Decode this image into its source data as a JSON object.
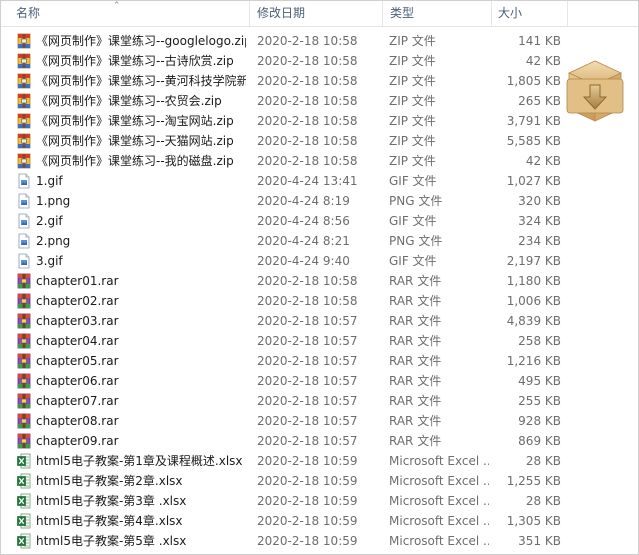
{
  "columns": {
    "name": "名称",
    "date": "修改日期",
    "type": "类型",
    "size": "大小"
  },
  "files": [
    {
      "icon": "zip",
      "name": "《网页制作》课堂练习--googlelogo.zip",
      "date": "2020-2-18 10:58",
      "type": "ZIP 文件",
      "size": "141 KB"
    },
    {
      "icon": "zip",
      "name": "《网页制作》课堂练习--古诗欣赏.zip",
      "date": "2020-2-18 10:58",
      "type": "ZIP 文件",
      "size": "42 KB"
    },
    {
      "icon": "zip",
      "name": "《网页制作》课堂练习--黄河科技学院新...",
      "date": "2020-2-18 10:58",
      "type": "ZIP 文件",
      "size": "1,805 KB"
    },
    {
      "icon": "zip",
      "name": "《网页制作》课堂练习--农贸会.zip",
      "date": "2020-2-18 10:58",
      "type": "ZIP 文件",
      "size": "265 KB"
    },
    {
      "icon": "zip",
      "name": "《网页制作》课堂练习--淘宝网站.zip",
      "date": "2020-2-18 10:58",
      "type": "ZIP 文件",
      "size": "3,791 KB"
    },
    {
      "icon": "zip",
      "name": "《网页制作》课堂练习--天猫网站.zip",
      "date": "2020-2-18 10:58",
      "type": "ZIP 文件",
      "size": "5,585 KB"
    },
    {
      "icon": "zip",
      "name": "《网页制作》课堂练习--我的磁盘.zip",
      "date": "2020-2-18 10:58",
      "type": "ZIP 文件",
      "size": "42 KB"
    },
    {
      "icon": "img",
      "name": "1.gif",
      "date": "2020-4-24 13:41",
      "type": "GIF 文件",
      "size": "1,027 KB"
    },
    {
      "icon": "img",
      "name": "1.png",
      "date": "2020-4-24 8:19",
      "type": "PNG 文件",
      "size": "320 KB"
    },
    {
      "icon": "img",
      "name": "2.gif",
      "date": "2020-4-24 8:56",
      "type": "GIF 文件",
      "size": "324 KB"
    },
    {
      "icon": "img",
      "name": "2.png",
      "date": "2020-4-24 8:21",
      "type": "PNG 文件",
      "size": "234 KB"
    },
    {
      "icon": "img",
      "name": "3.gif",
      "date": "2020-4-24 9:40",
      "type": "GIF 文件",
      "size": "2,197 KB"
    },
    {
      "icon": "rar",
      "name": "chapter01.rar",
      "date": "2020-2-18 10:58",
      "type": "RAR 文件",
      "size": "1,180 KB"
    },
    {
      "icon": "rar",
      "name": "chapter02.rar",
      "date": "2020-2-18 10:58",
      "type": "RAR 文件",
      "size": "1,006 KB"
    },
    {
      "icon": "rar",
      "name": "chapter03.rar",
      "date": "2020-2-18 10:57",
      "type": "RAR 文件",
      "size": "4,839 KB"
    },
    {
      "icon": "rar",
      "name": "chapter04.rar",
      "date": "2020-2-18 10:57",
      "type": "RAR 文件",
      "size": "258 KB"
    },
    {
      "icon": "rar",
      "name": "chapter05.rar",
      "date": "2020-2-18 10:57",
      "type": "RAR 文件",
      "size": "1,216 KB"
    },
    {
      "icon": "rar",
      "name": "chapter06.rar",
      "date": "2020-2-18 10:57",
      "type": "RAR 文件",
      "size": "495 KB"
    },
    {
      "icon": "rar",
      "name": "chapter07.rar",
      "date": "2020-2-18 10:57",
      "type": "RAR 文件",
      "size": "255 KB"
    },
    {
      "icon": "rar",
      "name": "chapter08.rar",
      "date": "2020-2-18 10:57",
      "type": "RAR 文件",
      "size": "928 KB"
    },
    {
      "icon": "rar",
      "name": "chapter09.rar",
      "date": "2020-2-18 10:57",
      "type": "RAR 文件",
      "size": "869 KB"
    },
    {
      "icon": "xlsx",
      "name": "html5电子教案-第1章及课程概述.xlsx",
      "date": "2020-2-18 10:59",
      "type": "Microsoft Excel ...",
      "size": "28 KB"
    },
    {
      "icon": "xlsx",
      "name": "html5电子教案-第2章.xlsx",
      "date": "2020-2-18 10:59",
      "type": "Microsoft Excel ...",
      "size": "1,255 KB"
    },
    {
      "icon": "xlsx",
      "name": "html5电子教案-第3章 .xlsx",
      "date": "2020-2-18 10:59",
      "type": "Microsoft Excel ...",
      "size": "28 KB"
    },
    {
      "icon": "xlsx",
      "name": "html5电子教案-第4章.xlsx",
      "date": "2020-2-18 10:59",
      "type": "Microsoft Excel ...",
      "size": "1,305 KB"
    },
    {
      "icon": "xlsx",
      "name": "html5电子教案-第5章 .xlsx",
      "date": "2020-2-18 10:59",
      "type": "Microsoft Excel ...",
      "size": "351 KB"
    }
  ],
  "preview": {
    "icon": "archive-box-download-icon"
  }
}
